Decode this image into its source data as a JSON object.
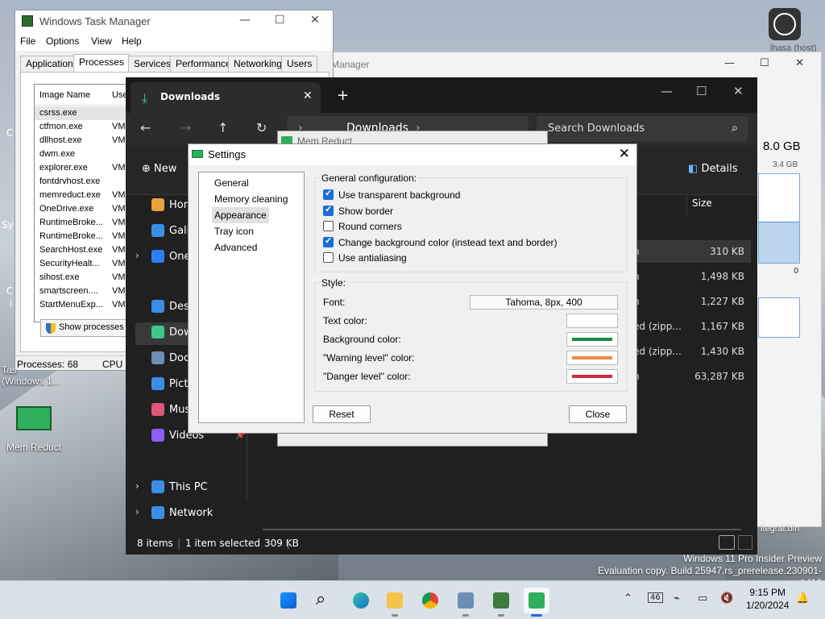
{
  "desktop": {
    "mem_reduct_icon_label": "Mem Reduct",
    "task_manager_label_line1": "Tas",
    "task_manager_label_line2": "(Windows 1...",
    "left_clip1": "C",
    "left_clip2": "Sy",
    "left_clip3": "C",
    "left_clip4": "l",
    "watermark_line1": "Windows 11 Pro Insider Preview",
    "watermark_line2": "Evaluation copy. Build 25947.rs_prerelease.230901-1416",
    "right_clip": "itegrat.bin",
    "user_label": "lhasa (host)"
  },
  "background_window": {
    "title": "Manager",
    "memory_total": "8.0 GB",
    "memory_used": "3.4 GB",
    "graph_zero": "0",
    "graph_fill_fraction": 0.46
  },
  "task_manager": {
    "title": "Windows Task Manager",
    "menu": [
      "File",
      "Options",
      "View",
      "Help"
    ],
    "tabs": [
      "Applications",
      "Processes",
      "Services",
      "Performance",
      "Networking",
      "Users"
    ],
    "active_tab": "Processes",
    "columns": {
      "image_name": "Image Name",
      "user": "Use"
    },
    "processes": [
      {
        "name": "csrss.exe",
        "user": ""
      },
      {
        "name": "ctfmon.exe",
        "user": "VM6"
      },
      {
        "name": "dllhost.exe",
        "user": "VM6"
      },
      {
        "name": "dwm.exe",
        "user": ""
      },
      {
        "name": "explorer.exe",
        "user": "VM6"
      },
      {
        "name": "fontdrvhost.exe",
        "user": ""
      },
      {
        "name": "memreduct.exe",
        "user": "VM6"
      },
      {
        "name": "OneDrive.exe",
        "user": "VM6"
      },
      {
        "name": "RuntimeBroke...",
        "user": "VM6"
      },
      {
        "name": "RuntimeBroke...",
        "user": "VM6"
      },
      {
        "name": "SearchHost.exe",
        "user": "VM6"
      },
      {
        "name": "SecurityHealt...",
        "user": "VM6"
      },
      {
        "name": "sihost.exe",
        "user": "VM6"
      },
      {
        "name": "smartscreen....",
        "user": "VM6"
      },
      {
        "name": "StartMenuExp...",
        "user": "VM6"
      }
    ],
    "show_processes_button": "Show processes fr",
    "status_processes": "Processes: 68",
    "status_cpu": "CPU U"
  },
  "explorer": {
    "tab_title": "Downloads",
    "address_parts": [
      "Downloads"
    ],
    "search_placeholder": "Search Downloads",
    "new_label": "New",
    "details_label": "Details",
    "size_header": "Size",
    "sidebar": [
      {
        "label": "Hom",
        "icon": "home-icon",
        "color": "#e6a23c"
      },
      {
        "label": "Galle",
        "icon": "gallery-icon",
        "color": "#3a8ee6"
      },
      {
        "label": "One",
        "icon": "onedrive-icon",
        "color": "#2d7ff9"
      },
      {
        "label": "Desk",
        "icon": "desktop-icon",
        "color": "#3a8ee6"
      },
      {
        "label": "Dow",
        "icon": "download-icon",
        "color": "#3cc98a"
      },
      {
        "label": "Doc",
        "icon": "documents-icon",
        "color": "#6b8fb5"
      },
      {
        "label": "Pictu",
        "icon": "pictures-icon",
        "color": "#3a8ee6"
      },
      {
        "label": "Musi",
        "icon": "music-icon",
        "color": "#e0557a"
      },
      {
        "label": "Videos",
        "icon": "videos-icon",
        "color": "#8b5cf6"
      },
      {
        "label": "This PC",
        "icon": "this-pc-icon",
        "color": "#3a8ee6"
      },
      {
        "label": "Network",
        "icon": "network-icon",
        "color": "#3a8ee6"
      }
    ],
    "files": [
      {
        "type": "n",
        "size": "310 KB"
      },
      {
        "type": "n",
        "size": "1,498 KB"
      },
      {
        "type": "n",
        "size": "1,227 KB"
      },
      {
        "type": "ed (zipp...",
        "size": "1,167 KB"
      },
      {
        "type": "ed (zipp...",
        "size": "1,430 KB"
      },
      {
        "type": "n",
        "size": "63,287 KB"
      }
    ],
    "status_items": "8 items",
    "status_selected": "1 item selected",
    "status_size": "309 KB"
  },
  "mem_reduct_window": {
    "title": "Mem Reduct"
  },
  "settings": {
    "title": "Settings",
    "nav": [
      "General",
      "Memory cleaning",
      "Appearance",
      "Tray icon",
      "Advanced"
    ],
    "selected_nav": "Appearance",
    "general_group": "General configuration:",
    "options": [
      {
        "label": "Use transparent background",
        "checked": true
      },
      {
        "label": "Show border",
        "checked": true
      },
      {
        "label": "Round corners",
        "checked": false
      },
      {
        "label": "Change background color (instead text and border)",
        "checked": true
      },
      {
        "label": "Use antialiasing",
        "checked": false
      }
    ],
    "style_group": "Style:",
    "font_label": "Font:",
    "font_value": "Tahoma, 8px, 400",
    "text_color_label": "Text color:",
    "background_color_label": "Background color:",
    "warning_color_label": "\"Warning level\" color:",
    "danger_color_label": "\"Danger level\" color:",
    "colors": {
      "text": "#ffffff",
      "background": "#1f8a4c",
      "warning": "#f0884a",
      "danger": "#d42a3c"
    },
    "reset_button": "Reset",
    "close_button": "Close"
  },
  "taskbar": {
    "tray_badge": "46",
    "time": "9:15 PM",
    "date": "1/20/2024"
  }
}
